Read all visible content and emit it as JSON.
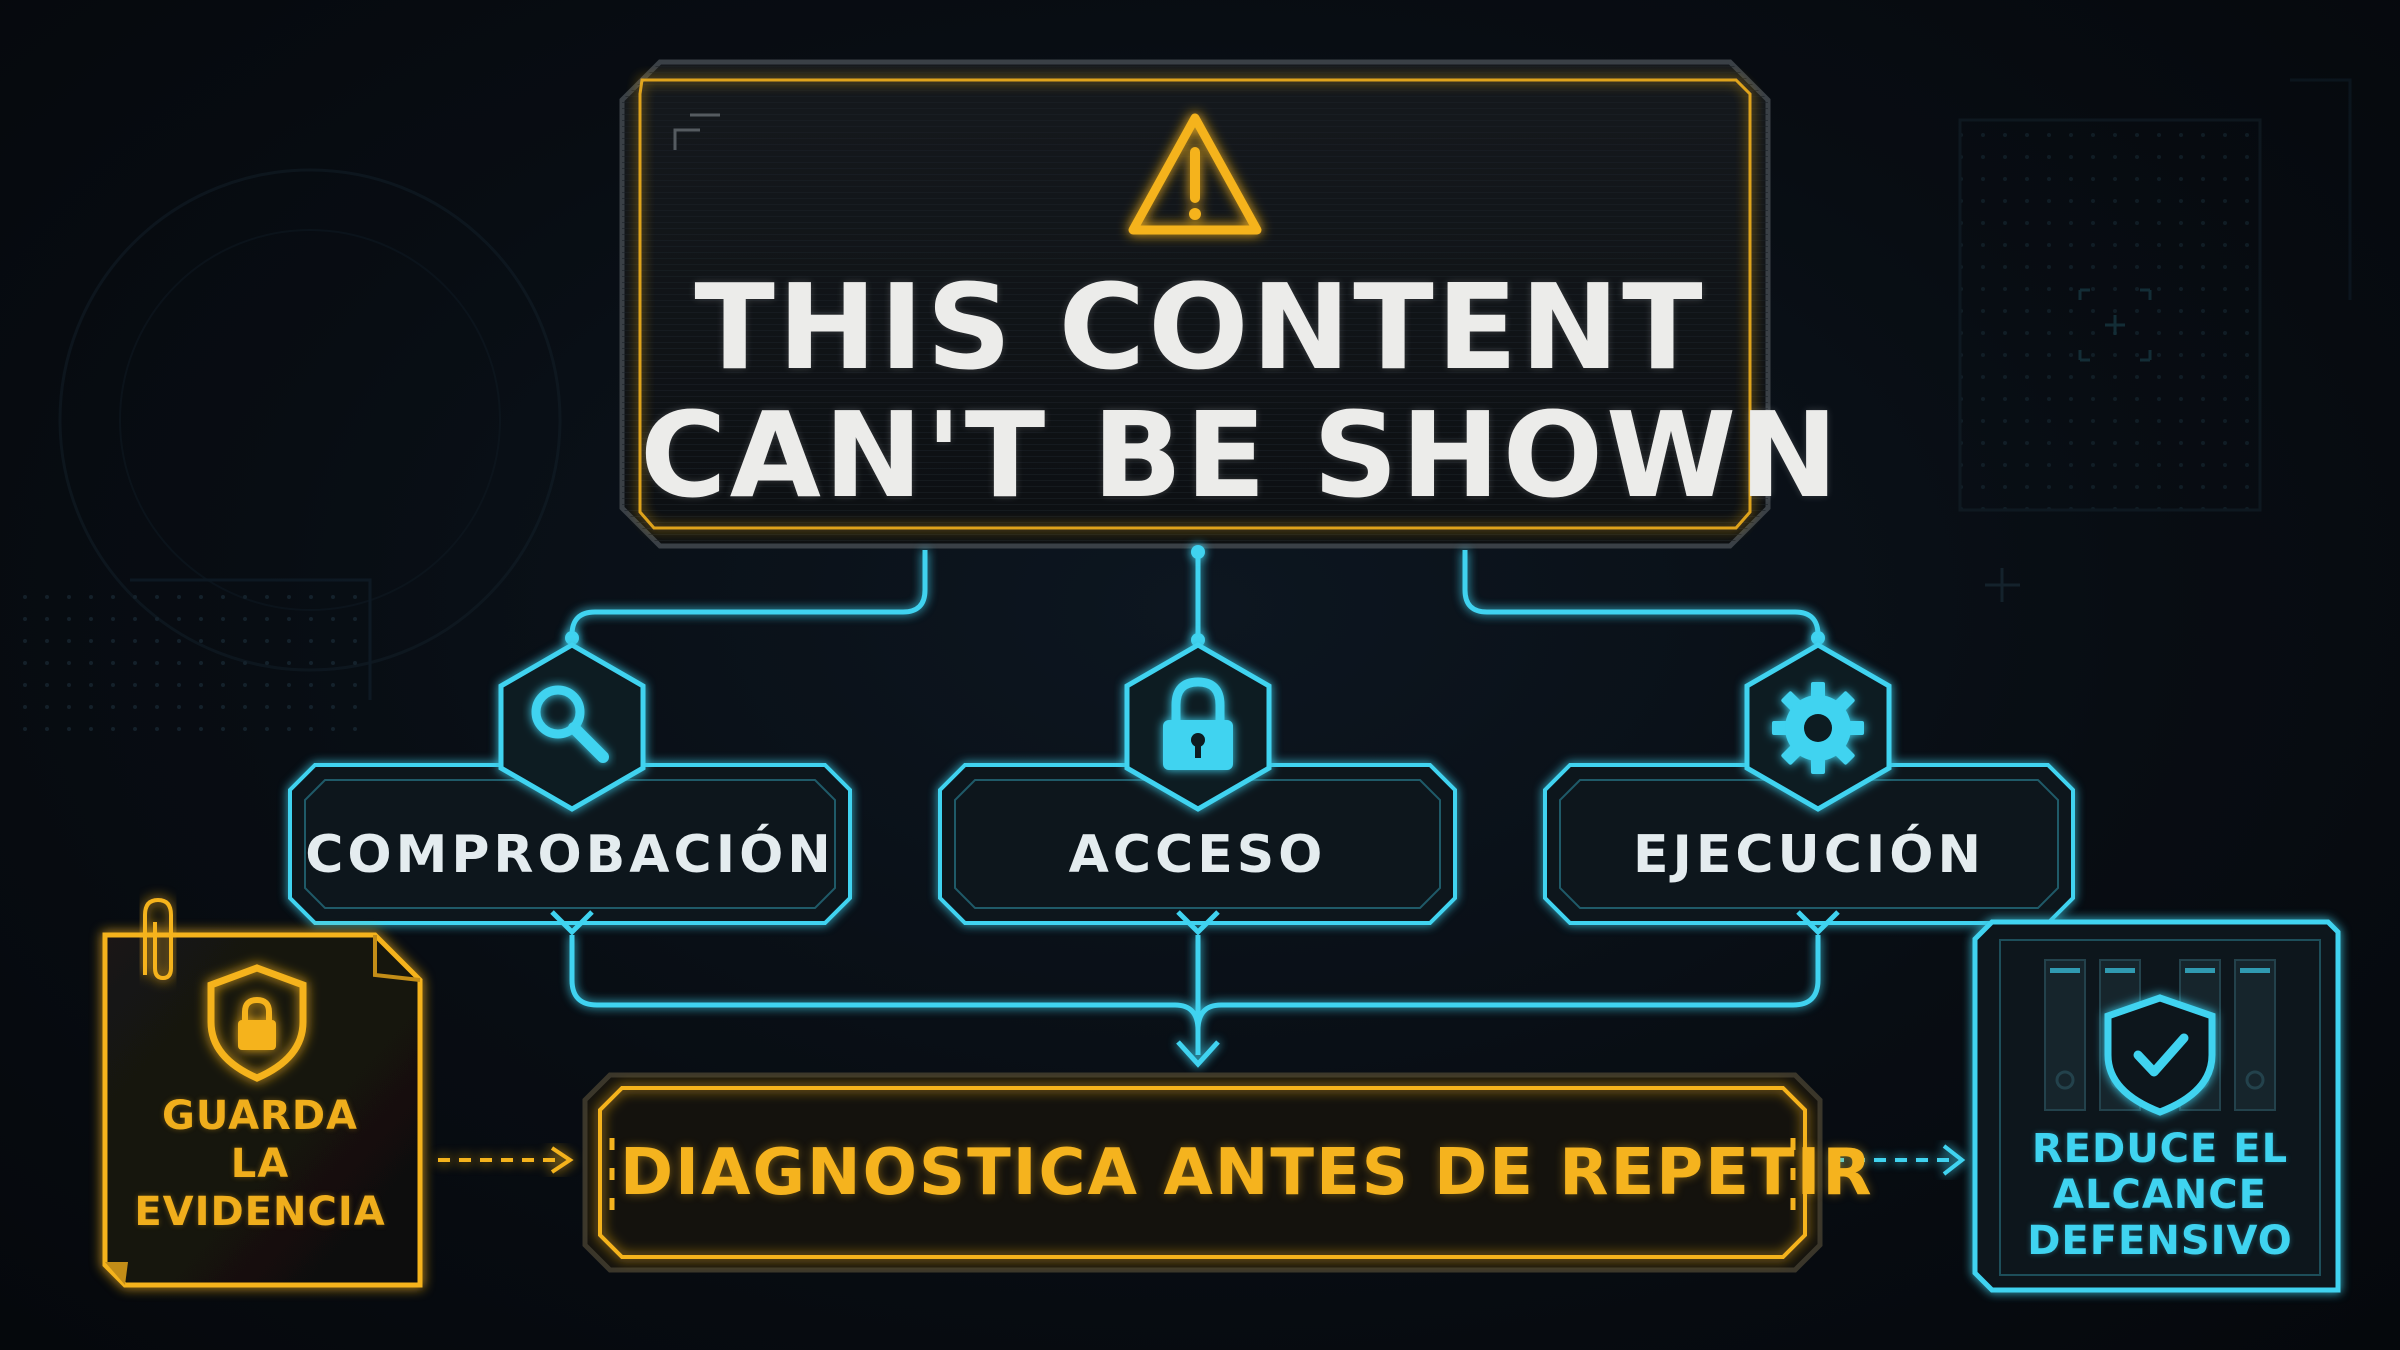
{
  "header": {
    "title_line1": "THIS CONTENT",
    "title_line2": "CAN'T BE SHOWN",
    "icon": "warning-icon"
  },
  "branches": [
    {
      "label": "COMPROBACIÓN",
      "icon": "magnifier-icon"
    },
    {
      "label": "ACCESO",
      "icon": "lock-icon"
    },
    {
      "label": "EJECUCIÓN",
      "icon": "gear-icon"
    }
  ],
  "action": {
    "label": "DIAGNOSTICA ANTES DE REPETIR"
  },
  "left_note": {
    "line1": "GUARDA",
    "line2": "LA",
    "line3": "EVIDENCIA",
    "icon": "shield-lock-icon"
  },
  "right_note": {
    "line1": "REDUCE EL",
    "line2": "ALCANCE",
    "line3": "DEFENSIVO",
    "icon": "shield-check-icon"
  },
  "colors": {
    "amber": "#f5b31e",
    "cyan": "#3fd3f0",
    "background": "#070b10",
    "text": "#ececea"
  }
}
